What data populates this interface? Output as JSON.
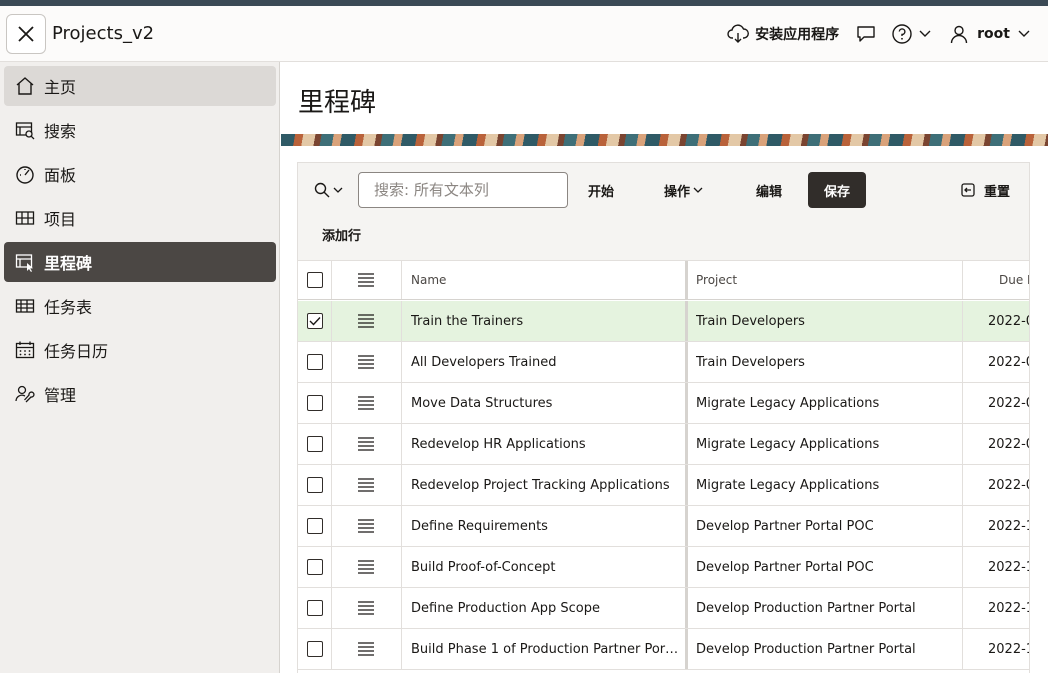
{
  "header": {
    "app_title": "Projects_v2",
    "install_label": "安装应用程序",
    "user_label": "root"
  },
  "nav": {
    "items": [
      {
        "label": "主页"
      },
      {
        "label": "搜索"
      },
      {
        "label": "面板"
      },
      {
        "label": "项目"
      },
      {
        "label": "里程碑"
      },
      {
        "label": "任务表"
      },
      {
        "label": "任务日历"
      },
      {
        "label": "管理"
      }
    ]
  },
  "page": {
    "title": "里程碑"
  },
  "toolbar": {
    "search_placeholder": "搜索: 所有文本列",
    "go_label": "开始",
    "actions_label": "操作",
    "edit_label": "编辑",
    "save_label": "保存",
    "reset_label": "重置",
    "add_row_label": "添加行"
  },
  "grid": {
    "columns": {
      "name": "Name",
      "project": "Project",
      "due": "Due D"
    },
    "rows": [
      {
        "name": "Train the Trainers",
        "project": "Train Developers",
        "due": "2022-0",
        "checked": true
      },
      {
        "name": "All Developers Trained",
        "project": "Train Developers",
        "due": "2022-0",
        "checked": false
      },
      {
        "name": "Move Data Structures",
        "project": "Migrate Legacy Applications",
        "due": "2022-0",
        "checked": false
      },
      {
        "name": "Redevelop HR Applications",
        "project": "Migrate Legacy Applications",
        "due": "2022-0",
        "checked": false
      },
      {
        "name": "Redevelop Project Tracking Applications",
        "project": "Migrate Legacy Applications",
        "due": "2022-0",
        "checked": false
      },
      {
        "name": "Define Requirements",
        "project": "Develop Partner Portal POC",
        "due": "2022-1",
        "checked": false
      },
      {
        "name": "Build Proof-of-Concept",
        "project": "Develop Partner Portal POC",
        "due": "2022-1",
        "checked": false
      },
      {
        "name": "Define Production App Scope",
        "project": "Develop Production Partner Portal",
        "due": "2022-1",
        "checked": false
      },
      {
        "name": "Build Phase 1 of Production Partner Por…",
        "project": "Develop Production Partner Portal",
        "due": "2022-1",
        "checked": false
      }
    ]
  }
}
